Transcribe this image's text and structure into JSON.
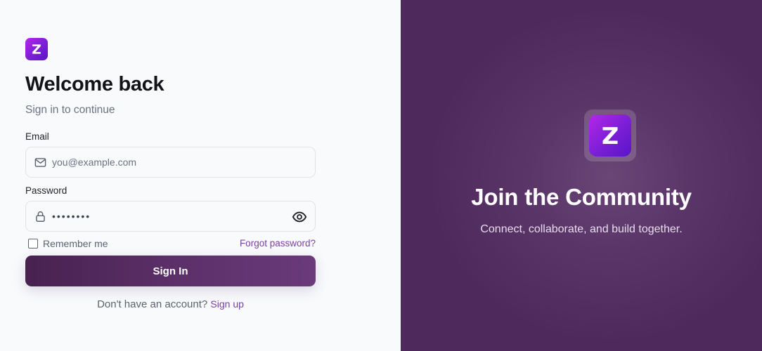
{
  "brand": {
    "logo_letter": "Z",
    "accent_color": "#7a1fd6",
    "button_color": "#5b2f68"
  },
  "login": {
    "title": "Welcome back",
    "subtitle": "Sign in to continue",
    "email_label": "Email",
    "email_placeholder": "you@example.com",
    "password_label": "Password",
    "password_value": "••••••••",
    "remember_label": "Remember me",
    "forgot_label": "Forgot password?",
    "signin_label": "Sign In",
    "no_account_text": "Don't have an account?",
    "signup_label": "Sign up"
  },
  "promo": {
    "title": "Join the Community",
    "subtitle": "Connect, collaborate, and build together."
  },
  "icons": {
    "email": "mail-icon",
    "password": "lock-icon",
    "visibility": "eye-icon"
  }
}
